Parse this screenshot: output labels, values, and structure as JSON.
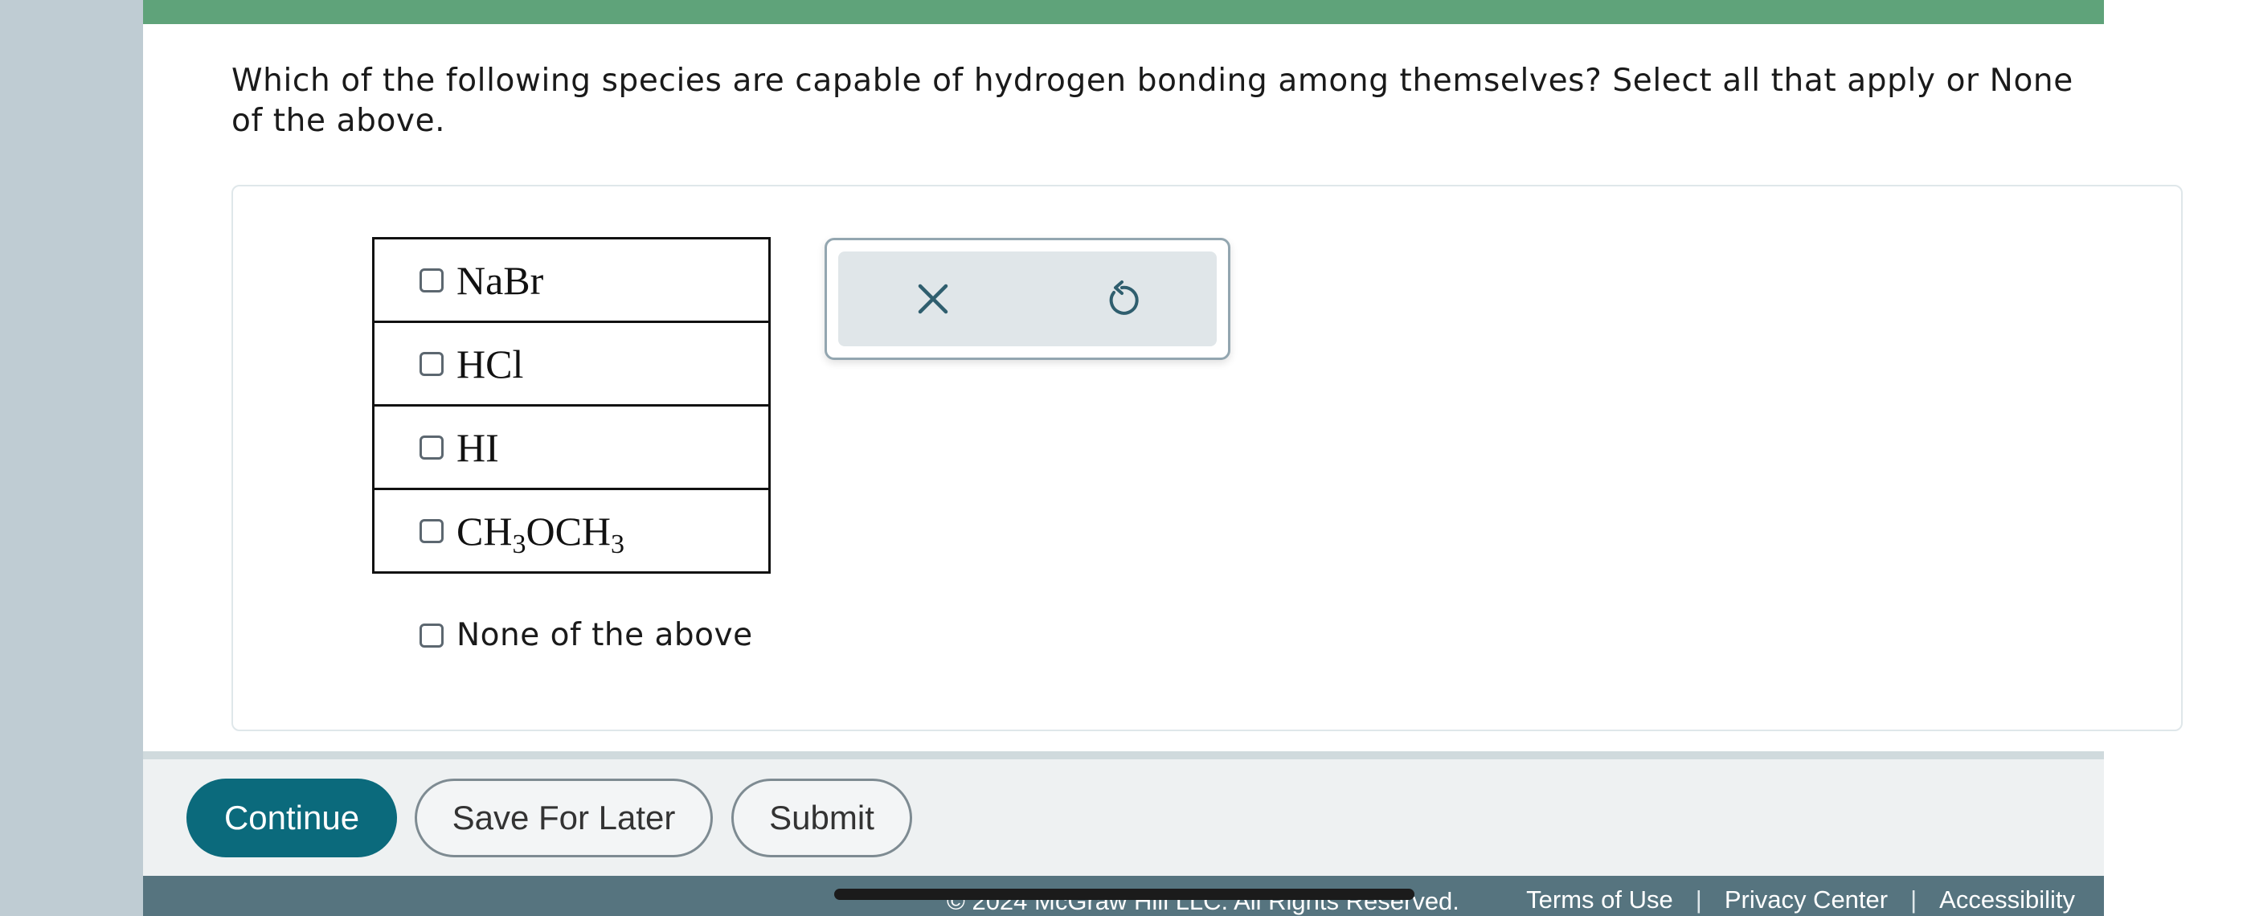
{
  "question": {
    "text": "Which of the following species are capable of hydrogen bonding among themselves? Select all that apply or None of the above."
  },
  "choices": [
    {
      "parts": [
        {
          "t": "NaBr",
          "sub": false
        }
      ]
    },
    {
      "parts": [
        {
          "t": "HCl",
          "sub": false
        }
      ]
    },
    {
      "parts": [
        {
          "t": "HI",
          "sub": false
        }
      ]
    },
    {
      "parts": [
        {
          "t": "CH",
          "sub": false
        },
        {
          "t": "3",
          "sub": true
        },
        {
          "t": "OCH",
          "sub": false
        },
        {
          "t": "3",
          "sub": true
        }
      ]
    }
  ],
  "none_option": {
    "label": "None of the above"
  },
  "tools": {
    "clear_icon": "close-icon",
    "reset_icon": "undo-icon"
  },
  "actions": {
    "continue_label": "Continue",
    "save_label": "Save For Later",
    "submit_label": "Submit"
  },
  "footer": {
    "copyright": "© 2024 McGraw Hill LLC. All Rights Reserved.",
    "links": [
      "Terms of Use",
      "Privacy Center",
      "Accessibility"
    ],
    "separator": "|"
  },
  "colors": {
    "top_bar": "#5fa37a",
    "primary": "#0b6a7c",
    "footer": "#56747f"
  }
}
